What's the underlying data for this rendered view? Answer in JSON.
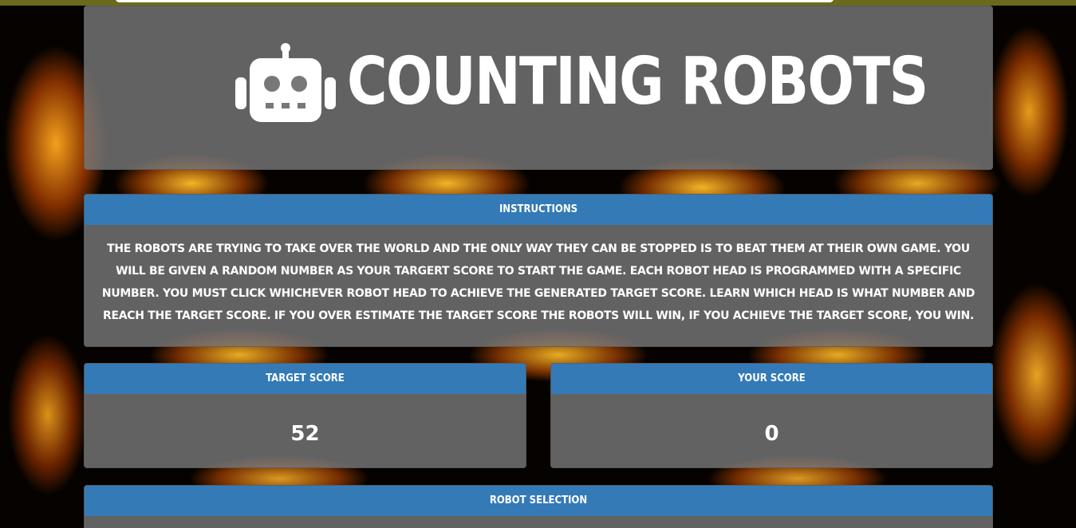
{
  "header": {
    "icon": "robot-icon",
    "title": "COUNTING ROBOTS"
  },
  "instructions": {
    "heading": "INSTRUCTIONS",
    "text": "THE ROBOTS ARE TRYING TO TAKE OVER THE WORLD AND THE ONLY WAY THEY CAN BE STOPPED IS TO BEAT THEM AT THEIR OWN GAME. YOU WILL BE GIVEN A RANDOM NUMBER AS YOUR TARGERT SCORE TO START THE GAME. EACH ROBOT HEAD IS PROGRAMMED WITH A SPECIFIC NUMBER. YOU MUST CLICK WHICHEVER ROBOT HEAD TO ACHIEVE THE GENERATED TARGET SCORE. LEARN WHICH HEAD IS WHAT NUMBER AND REACH THE TARGET SCORE. IF YOU OVER ESTIMATE THE TARGET SCORE THE ROBOTS WILL WIN, IF YOU ACHIEVE THE TARGET SCORE, YOU WIN."
  },
  "target_score": {
    "heading": "TARGET SCORE",
    "value": "52"
  },
  "your_score": {
    "heading": "YOUR SCORE",
    "value": "0"
  },
  "robot_selection": {
    "heading": "ROBOT SELECTION"
  },
  "colors": {
    "panel_header": "#337ab7",
    "panel_body": "#787878",
    "top_bar": "#6b6a1c"
  }
}
